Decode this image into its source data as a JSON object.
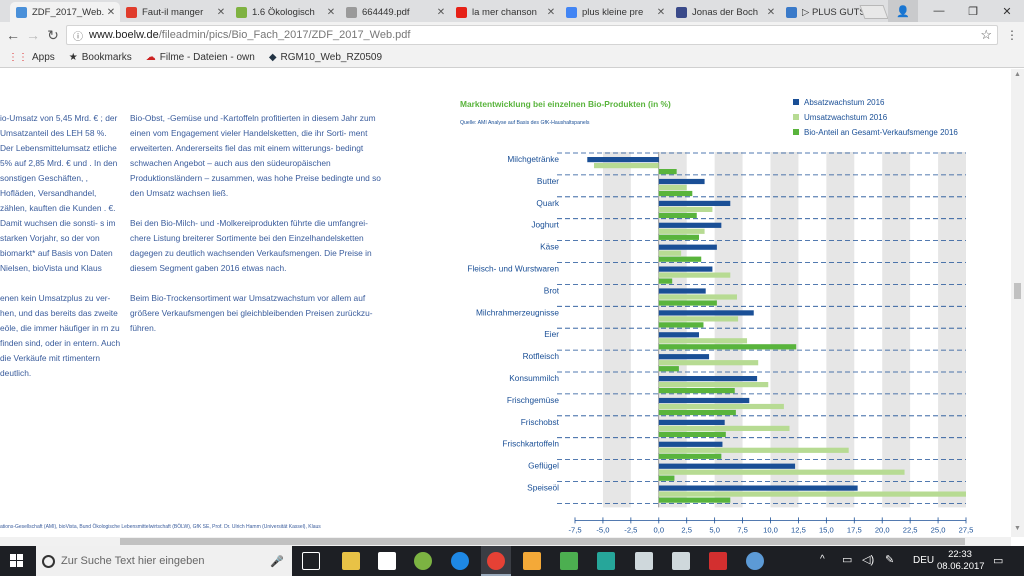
{
  "browser": {
    "tabs": [
      {
        "title": "ZDF_2017_Web.",
        "icon": "page-icon",
        "color": "#4a90d9",
        "active": true
      },
      {
        "title": "Faut-il manger",
        "icon": "pdf-icon",
        "color": "#e03c2c"
      },
      {
        "title": "1.6 Ökologisch",
        "icon": "green-site-icon",
        "color": "#7fb241"
      },
      {
        "title": "664449.pdf",
        "icon": "document-icon",
        "color": "#9a9a9a"
      },
      {
        "title": "la mer chanson",
        "icon": "youtube-icon",
        "color": "#e62117"
      },
      {
        "title": "plus kleine pre",
        "icon": "google-icon",
        "color": "#4285f4"
      },
      {
        "title": "Jonas der Boch",
        "icon": "flag-icon",
        "color": "#3a4a8a"
      },
      {
        "title": "▷ PLUS GUTSC",
        "icon": "bz-icon",
        "color": "#3a7ac9"
      }
    ],
    "url_host": "www.boelw.de",
    "url_path": "/fileadmin/pics/Bio_Fach_2017/ZDF_2017_Web.pdf",
    "bookmarks": [
      {
        "label": "Apps",
        "icon": "apps-grid-icon"
      },
      {
        "label": "Bookmarks",
        "icon": "star-icon"
      },
      {
        "label": "Filme - Dateien - own",
        "icon": "cloud-icon"
      },
      {
        "label": "RGM10_Web_RZ0509",
        "icon": "logo-icon"
      }
    ]
  },
  "document": {
    "left_column": [
      "io-Umsatz von 5,45 Mrd. € ; der Umsatzanteil des LEH 58 %. Der Lebensmittelumsatz etliche 5% auf 2,85 Mrd. € und . In den sonstigen Geschäften, , Hofläden, Versandhandel, zählen, kauften die Kunden . €. Damit wuchsen die sonsti- s im starken Vorjahr, so der von biomarkt* auf Basis von Daten Nielsen, bioVista und Klaus",
      "enen kein Umsatzplus zu ver- hen, und das bereits das zweite eöle, die immer häufiger in rn zu finden sind, oder in entern. Auch die Verkäufe mit rtimentern deutlich."
    ],
    "middle_column": [
      "Bio-Obst, -Gemüse und -Kartoffeln profitierten in diesem Jahr zum einen vom Engagement vieler Handelsketten, die ihr Sorti- ment erweiterten. Andererseits fiel das mit einem witterungs- bedingt schwachen Angebot – auch aus den südeuropäischen Produktionsländern – zusammen, was hohe Preise bedingte und so den Umsatz wachsen ließ.",
      "Bei den Bio-Milch- und -Molkereiprodukten führte die umfangrei- chere Listung breiterer Sortimente bei den Einzelhandelsketten dagegen zu deutlich wachsenden Verkaufsmengen. Die Preise in diesem Segment gaben 2016 etwas nach.",
      "Beim Bio-Trockensortiment war Umsatzwachstum vor allem auf größere Verkaufsmengen bei gleichbleibenden Preisen zurückzu- führen."
    ],
    "footer": "ations-Gesellschaft (AMI), bioVista, Bund Ökologische Lebensmittelwirtschaft (BÖLW), GfK SE, Prof. Dr. Ulrich Hamm (Universität Kassel), Klaus"
  },
  "chart_data": {
    "type": "bar",
    "orientation": "horizontal",
    "title": "Marktentwicklung bei einzelnen Bio-Produkten (in %)",
    "source": "Quelle: AMI Analyse auf Basis des GfK-Haushaltspanels",
    "xlabel": "%",
    "xlim": [
      -7.5,
      27.5
    ],
    "xticks": [
      -7.5,
      -5.0,
      -2.5,
      0.0,
      2.5,
      5.0,
      7.5,
      10.0,
      12.5,
      15.0,
      17.5,
      20.0,
      22.5,
      25.0,
      27.5
    ],
    "xtick_labels": [
      "-7,5",
      "-5,0",
      "-2,5",
      "0,0",
      "2,5",
      "5,0",
      "7,5",
      "10,0",
      "12,5",
      "15,0",
      "17,5",
      "20,0",
      "22,5",
      "25,0",
      "27,5"
    ],
    "legend_position": "top-right",
    "categories": [
      "Milchgetränke",
      "Butter",
      "Quark",
      "Joghurt",
      "Käse",
      "Fleisch- und Wurstwaren",
      "Brot",
      "Milchrahmerzeugnisse",
      "Eier",
      "Rotfleisch",
      "Konsummilch",
      "Frischgemüse",
      "Frischobst",
      "Frischkartoffeln",
      "Geflügel",
      "Speiseöl"
    ],
    "series": [
      {
        "name": "Absatzwachstum 2016",
        "color": "#1a4f96",
        "values": [
          -6.4,
          4.1,
          6.4,
          5.6,
          5.2,
          4.8,
          4.2,
          8.5,
          3.6,
          4.5,
          8.8,
          8.1,
          5.9,
          5.7,
          12.2,
          17.8
        ]
      },
      {
        "name": "Umsatzwachstum 2016",
        "color": "#b7db93",
        "values": [
          -5.8,
          2.5,
          4.8,
          4.1,
          2.0,
          6.4,
          7.0,
          7.1,
          7.9,
          8.9,
          9.8,
          11.2,
          11.7,
          17.0,
          22.0,
          27.5
        ]
      },
      {
        "name": "Bio-Anteil an Gesamt-Verkaufsmenge 2016",
        "color": "#59b43c",
        "values": [
          1.6,
          3.0,
          3.4,
          3.6,
          3.8,
          1.2,
          5.2,
          4.0,
          12.3,
          1.8,
          6.8,
          6.9,
          6.0,
          5.6,
          1.4,
          6.4
        ]
      }
    ]
  },
  "taskbar": {
    "search_placeholder": "Zur Suche Text hier eingeben",
    "language": "DEU",
    "time": "22:33",
    "date": "08.06.2017"
  }
}
